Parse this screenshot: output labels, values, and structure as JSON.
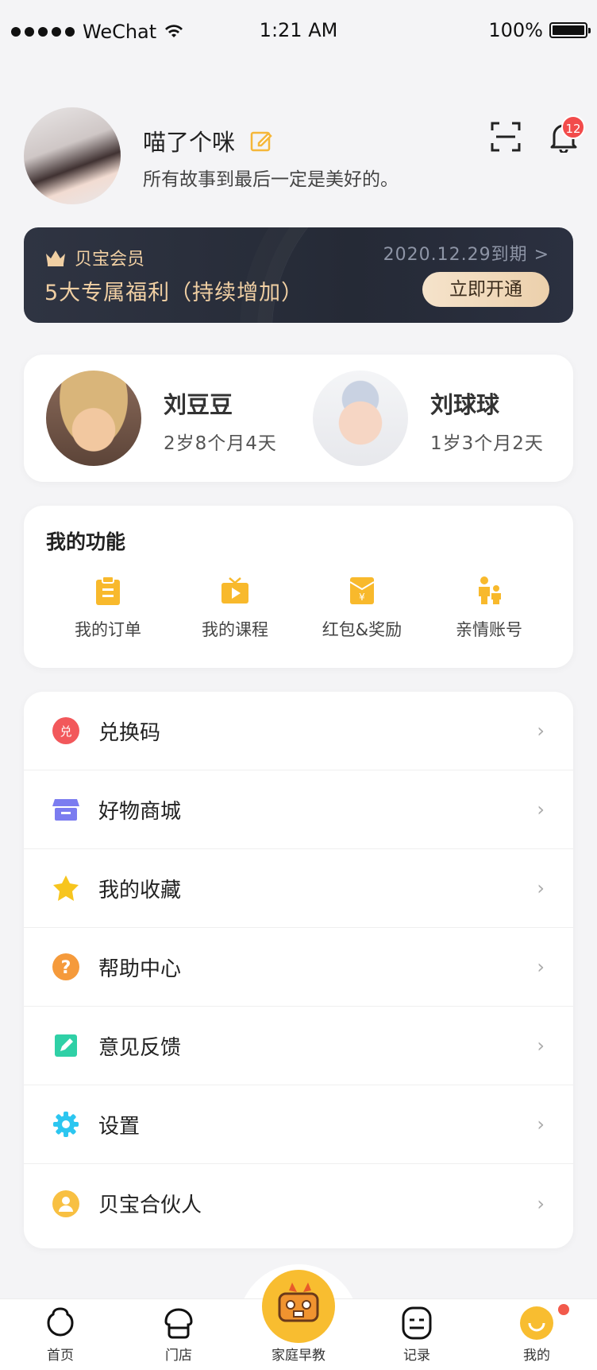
{
  "status_bar": {
    "carrier": "WeChat",
    "time": "1:21 AM",
    "battery": "100%"
  },
  "profile": {
    "name": "喵了个咪",
    "motto": "所有故事到最后一定是美好的。",
    "notification_count": "12"
  },
  "vip": {
    "title": "贝宝会员",
    "benefit": "5大专属福利（持续增加）",
    "expiry": "2020.12.29到期 >",
    "button": "立即开通"
  },
  "kids": [
    {
      "name": "刘豆豆",
      "age": "2岁8个月4天"
    },
    {
      "name": "刘球球",
      "age": "1岁3个月2天"
    }
  ],
  "features": {
    "title": "我的功能",
    "items": [
      {
        "label": "我的订单",
        "icon": "order-clipboard-icon"
      },
      {
        "label": "我的课程",
        "icon": "course-tv-icon"
      },
      {
        "label": "红包&奖励",
        "icon": "red-envelope-icon"
      },
      {
        "label": "亲情账号",
        "icon": "family-icon"
      }
    ]
  },
  "menu": [
    {
      "label": "兑换码",
      "icon": "redeem-icon",
      "color": "#f2585b"
    },
    {
      "label": "好物商城",
      "icon": "store-icon",
      "color": "#7b7cf0"
    },
    {
      "label": "我的收藏",
      "icon": "star-icon",
      "color": "#f7c51e"
    },
    {
      "label": "帮助中心",
      "icon": "help-icon",
      "color": "#f59a3b"
    },
    {
      "label": "意见反馈",
      "icon": "feedback-icon",
      "color": "#2fd0a6"
    },
    {
      "label": "设置",
      "icon": "settings-gear-icon",
      "color": "#2cc6f0"
    },
    {
      "label": "贝宝合伙人",
      "icon": "partner-icon",
      "color": "#f8c042"
    }
  ],
  "tabs": [
    {
      "label": "首页",
      "icon": "home-icon"
    },
    {
      "label": "门店",
      "icon": "store-tab-icon"
    },
    {
      "label": "家庭早教",
      "icon": "early-education-icon"
    },
    {
      "label": "记录",
      "icon": "record-icon"
    },
    {
      "label": "我的",
      "icon": "me-icon"
    }
  ],
  "colors": {
    "accent": "#f8bd30",
    "vip_gold": "#f0cfa3",
    "vip_bg": "#2a2f3b"
  }
}
